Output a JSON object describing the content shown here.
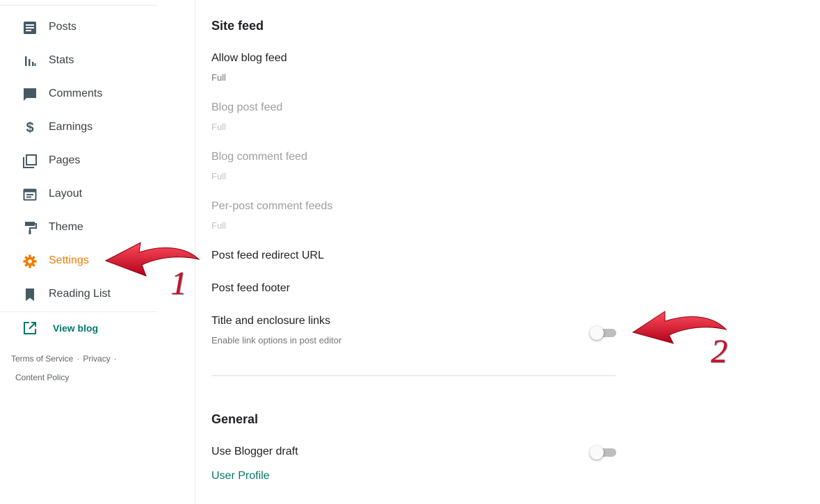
{
  "sidebar": {
    "items": [
      {
        "label": "Posts",
        "icon": "posts-icon"
      },
      {
        "label": "Stats",
        "icon": "stats-icon"
      },
      {
        "label": "Comments",
        "icon": "comments-icon"
      },
      {
        "label": "Earnings",
        "icon": "dollar-icon"
      },
      {
        "label": "Pages",
        "icon": "pages-icon"
      },
      {
        "label": "Layout",
        "icon": "layout-icon"
      },
      {
        "label": "Theme",
        "icon": "paint-roller-icon"
      },
      {
        "label": "Settings",
        "icon": "gear-icon",
        "active": true
      },
      {
        "label": "Reading List",
        "icon": "bookmark-icon"
      }
    ],
    "view_blog": "View blog",
    "footer": {
      "terms": "Terms of Service",
      "privacy": "Privacy",
      "content_policy": "Content Policy",
      "separator": "·"
    }
  },
  "site_feed": {
    "title": "Site feed",
    "allow_blog_feed": {
      "name": "Allow blog feed",
      "value": "Full"
    },
    "blog_post_feed": {
      "name": "Blog post feed",
      "value": "Full"
    },
    "blog_comment_feed": {
      "name": "Blog comment feed",
      "value": "Full"
    },
    "per_post_comment_feeds": {
      "name": "Per-post comment feeds",
      "value": "Full"
    },
    "post_feed_redirect_url": {
      "name": "Post feed redirect URL"
    },
    "post_feed_footer": {
      "name": "Post feed footer"
    },
    "title_enclosure_links": {
      "name": "Title and enclosure links",
      "sub": "Enable link options in post editor",
      "enabled": false
    }
  },
  "general": {
    "title": "General",
    "use_blogger_draft": {
      "name": "Use Blogger draft",
      "enabled": false
    },
    "user_profile_link": "User Profile"
  },
  "annotations": [
    {
      "label": "1"
    },
    {
      "label": "2"
    }
  ],
  "colors": {
    "accent_orange": "#f57c00",
    "link_teal": "#00796b",
    "annotation_red": "#c8102e"
  }
}
